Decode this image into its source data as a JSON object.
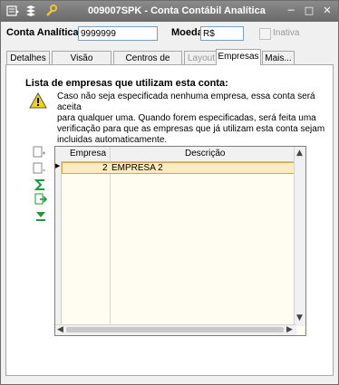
{
  "window": {
    "title": "009007SPK - Conta Contábil Analítica",
    "controls": [
      "minimize-icon",
      "maximize-icon",
      "close-icon"
    ]
  },
  "header": {
    "conta_label": "Conta Analítica:",
    "conta_value": "9999999",
    "moeda_label": "Moeda:",
    "moeda_value": "R$",
    "inativa_label": "Inativa",
    "inativa_checked": false
  },
  "tabs": [
    {
      "label": "Detalhes",
      "state": "normal"
    },
    {
      "label": "Visão Contábil",
      "state": "normal"
    },
    {
      "label": "Centros de custo",
      "state": "normal"
    },
    {
      "label": "Layout",
      "state": "disabled"
    },
    {
      "label": "Empresas",
      "state": "active"
    },
    {
      "label": "Mais...",
      "state": "normal"
    }
  ],
  "panel": {
    "title": "Lista de empresas que utilizam esta conta:",
    "info_lines": [
      "Caso não seja especificada nenhuma empresa, essa conta será aceita",
      "para qualquer uma. Quando forem especificadas, será feita uma",
      "verificação para que as empresas que já utilizam esta conta sejam",
      "incluidas automaticamente."
    ]
  },
  "grid": {
    "columns": [
      "Empresa",
      "Descrição"
    ],
    "rows": [
      {
        "empresa": "2",
        "descricao": "EMPRESA 2"
      }
    ]
  },
  "colors": {
    "titlebar": "#7a7a7a",
    "selected_row": "#f9ebc2",
    "grid_bg": "#fffdf2"
  }
}
